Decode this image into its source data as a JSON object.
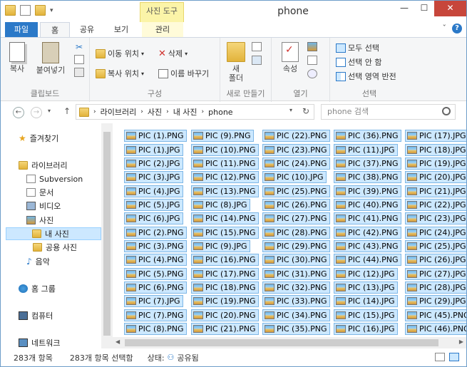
{
  "window": {
    "title": "phone",
    "context_tab": "사진 도구"
  },
  "ribbon_tabs": [
    "파일",
    "홈",
    "공유",
    "보기",
    "관리"
  ],
  "clipboard": {
    "copy": "복사",
    "paste": "붙여넣기",
    "label": "클립보드"
  },
  "organize": {
    "move_to": "이동 위치",
    "copy_to": "복사 위치",
    "delete": "삭제",
    "rename": "이름 바꾸기",
    "label": "구성"
  },
  "new_group": {
    "new_folder_line1": "새",
    "new_folder_line2": "폴더",
    "label": "새로 만들기"
  },
  "open_group": {
    "properties": "속성",
    "label": "열기"
  },
  "select_group": {
    "select_all": "모두 선택",
    "select_none": "선택 안 함",
    "invert": "선택 영역 반전",
    "label": "선택"
  },
  "address": {
    "path": [
      "라이브러리",
      "사진",
      "내 사진",
      "phone"
    ],
    "search_placeholder": "phone 검색"
  },
  "nav": {
    "favorites": "즐겨찾기",
    "libraries": "라이브러리",
    "subversion": "Subversion",
    "documents": "문서",
    "videos": "비디오",
    "pictures": "사진",
    "my_pictures": "내 사진",
    "public_pictures": "공용 사진",
    "music": "음악",
    "homegroup": "홈 그룹",
    "computer": "컴퓨터",
    "network": "네트워크"
  },
  "files": {
    "col1": [
      "PIC (1).PNG",
      "PIC (1).JPG",
      "PIC (2).JPG",
      "PIC (3).JPG",
      "PIC (4).JPG",
      "PIC (5).JPG",
      "PIC (6).JPG",
      "PIC (2).PNG",
      "PIC (3).PNG",
      "PIC (4).PNG",
      "PIC (5).PNG",
      "PIC (6).PNG",
      "PIC (7).JPG",
      "PIC (7).PNG",
      "PIC (8).PNG"
    ],
    "col2": [
      "PIC (9).PNG",
      "PIC (10).PNG",
      "PIC (11).PNG",
      "PIC (12).PNG",
      "PIC (13).PNG",
      "PIC (8).JPG",
      "PIC (14).PNG",
      "PIC (15).PNG",
      "PIC (9).JPG",
      "PIC (16).PNG",
      "PIC (17).PNG",
      "PIC (18).PNG",
      "PIC (19).PNG",
      "PIC (20).PNG",
      "PIC (21).PNG"
    ],
    "col3": [
      "PIC (22).PNG",
      "PIC (23).PNG",
      "PIC (24).PNG",
      "PIC (10).JPG",
      "PIC (25).PNG",
      "PIC (26).PNG",
      "PIC (27).PNG",
      "PIC (28).PNG",
      "PIC (29).PNG",
      "PIC (30).PNG",
      "PIC (31).PNG",
      "PIC (32).PNG",
      "PIC (33).PNG",
      "PIC (34).PNG",
      "PIC (35).PNG"
    ],
    "col4": [
      "PIC (36).PNG",
      "PIC (11).JPG",
      "PIC (37).PNG",
      "PIC (38).PNG",
      "PIC (39).PNG",
      "PIC (40).PNG",
      "PIC (41).PNG",
      "PIC (42).PNG",
      "PIC (43).PNG",
      "PIC (44).PNG",
      "PIC (12).JPG",
      "PIC (13).JPG",
      "PIC (14).JPG",
      "PIC (15).JPG",
      "PIC (16).JPG"
    ],
    "col5": [
      "PIC (17).JPG",
      "PIC (18).JPG",
      "PIC (19).JPG",
      "PIC (20).JPG",
      "PIC (21).JPG",
      "PIC (22).JPG",
      "PIC (23).JPG",
      "PIC (24).JPG",
      "PIC (25).JPG",
      "PIC (26).JPG",
      "PIC (27).JPG",
      "PIC (28).JPG",
      "PIC (29).JPG",
      "PIC (45).PNG",
      "PIC (46).PNG"
    ]
  },
  "status": {
    "count": "283개 항목",
    "selected": "283개 항목 선택함",
    "state_label": "상태:",
    "state_value": "공유됨"
  }
}
